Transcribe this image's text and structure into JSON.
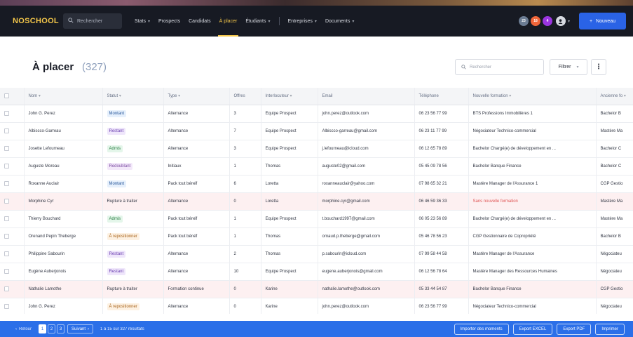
{
  "app": {
    "logo": "NOSCHOOL",
    "search_placeholder": "Rechercher",
    "nav": [
      {
        "label": "Stats",
        "dropdown": true,
        "active": false
      },
      {
        "label": "Prospects",
        "dropdown": false,
        "active": false
      },
      {
        "label": "Candidats",
        "dropdown": false,
        "active": false
      },
      {
        "label": "À placer",
        "dropdown": false,
        "active": true
      },
      {
        "label": "Étudiants",
        "dropdown": true,
        "active": false
      },
      {
        "label": "Entreprises",
        "dropdown": true,
        "active": false
      },
      {
        "label": "Documents",
        "dropdown": true,
        "active": false
      }
    ],
    "avatars": [
      {
        "label": "23",
        "color": "#6b7c93"
      },
      {
        "label": "18",
        "color": "#f0663a"
      },
      {
        "label": "4",
        "color": "#9b35e0"
      }
    ],
    "new_button": "Nouveau"
  },
  "page": {
    "title": "À placer",
    "count": "(327)",
    "search_placeholder": "Rechercher",
    "filter_label": "Filtrer",
    "more_label": "⋮"
  },
  "table": {
    "columns": [
      "Nom",
      "Statut",
      "Type",
      "Offres",
      "Interlocuteur",
      "Email",
      "Téléphone",
      "Nouvelle formation",
      "Ancienne fo"
    ],
    "rows": [
      {
        "nom": "John G. Perez",
        "statut": "Montant",
        "type": "Alternance",
        "offres": "3",
        "interlocuteur": "Equipe Prospect",
        "email": "john.perez@outlook.com",
        "tel": "06 23 56 77 99",
        "nouvelle": "BTS Professions Immobilières 1",
        "ancienne": "Bachelor B",
        "alert": false
      },
      {
        "nom": "Albiscco-Garreau",
        "statut": "Restant",
        "type": "Alternance",
        "offres": "7",
        "interlocuteur": "Equipe Prospect",
        "email": "Albiscco-garreau@gmail.com",
        "tel": "06 23 11 77 99",
        "nouvelle": "Négociateur Technico-commercial",
        "ancienne": "Mastère Ma",
        "alert": false
      },
      {
        "nom": "Josette Lefourneau",
        "statut": "Admis",
        "type": "Alternance",
        "offres": "3",
        "interlocuteur": "Equipe Prospect",
        "email": "j.lefourneau@icloud.com",
        "tel": "06 12 65 78 89",
        "nouvelle": "Bachelor Chargé(e) de développement en ...",
        "ancienne": "Bachelor C",
        "alert": false
      },
      {
        "nom": "Auguste Moreau",
        "statut": "Redoublant",
        "type": "Initiaux",
        "offres": "1",
        "interlocuteur": "Thomas",
        "email": "auguste02@gmail.com",
        "tel": "05 45 09 78 56",
        "nouvelle": "Bachelor Banque Finance",
        "ancienne": "Bachelor C",
        "alert": false
      },
      {
        "nom": "Roxanne Auclair",
        "statut": "Montant",
        "type": "Pack tout bénéf",
        "offres": "6",
        "interlocuteur": "Loretta",
        "email": "roxanneauclair@yahoo.com",
        "tel": "07 98 65 32 21",
        "nouvelle": "Mastère Manager de l'Assurance 1",
        "ancienne": "CGP Gestio",
        "alert": false
      },
      {
        "nom": "Morphine Cyr",
        "statut": "Rupture à traiter",
        "type": "Alternance",
        "offres": "0",
        "interlocuteur": "Loretta",
        "email": "morphine.cyr@gmail.com",
        "tel": "06 46 59 36 33",
        "nouvelle": "Sans nouvelle formation",
        "ancienne": "Mastère Ma",
        "alert": true
      },
      {
        "nom": "Thierry Bouchard",
        "statut": "Admis",
        "type": "Pack tout bénéf",
        "offres": "1",
        "interlocuteur": "Equipe Prospect",
        "email": "t.bouchard1997@gmail.com",
        "tel": "06 05 23 56 89",
        "nouvelle": "Bachelor Chargé(e) de développement en ...",
        "ancienne": "Mastère Ma",
        "alert": false
      },
      {
        "nom": "Orenand Pepin Theberge",
        "statut": "À repositionner",
        "type": "Pack tout bénéf",
        "offres": "1",
        "interlocuteur": "Thomas",
        "email": "ornaud.p.theberge@gmail.com",
        "tel": "05 46 78 56 23",
        "nouvelle": "CGP Gestionnaire de Copropriété",
        "ancienne": "Bachelor B",
        "alert": false
      },
      {
        "nom": "Philippine Sabourin",
        "statut": "Restant",
        "type": "Alternance",
        "offres": "2",
        "interlocuteur": "Thomas",
        "email": "p.sabourin@icloud.com",
        "tel": "07 99 58 44 58",
        "nouvelle": "Mastère Manager de l'Assurance",
        "ancienne": "Négociateu",
        "alert": false
      },
      {
        "nom": "Eugène Auberjonois",
        "statut": "Restant",
        "type": "Alternance",
        "offres": "10",
        "interlocuteur": "Equipe Prospect",
        "email": "eugene.auberjonois@gmail.com",
        "tel": "06 12 56 78 64",
        "nouvelle": "Mastère Manager des Ressources Humaines",
        "ancienne": "Négociateu",
        "alert": false
      },
      {
        "nom": "Nathalie Lamothe",
        "statut": "Rupture à traiter",
        "type": "Formation continue",
        "offres": "0",
        "interlocuteur": "Karine",
        "email": "nathalie.lamothe@outlook.com",
        "tel": "05 33 44 54 87",
        "nouvelle": "Bachelor Banque Finance",
        "ancienne": "CGP Gestio",
        "alert": true
      },
      {
        "nom": "John G. Perez",
        "statut": "À repositionner",
        "type": "Alternance",
        "offres": "0",
        "interlocuteur": "Karine",
        "email": "john.perez@outlook.com",
        "tel": "06 23 56 77 99",
        "nouvelle": "Négociateur Technico-commercial",
        "ancienne": "Négociateu",
        "alert": false
      }
    ]
  },
  "badges": {
    "Montant": {
      "bg": "#e6f0fc",
      "fg": "#2c5a9c"
    },
    "Restant": {
      "bg": "#efe6fb",
      "fg": "#6a3fb0"
    },
    "Admis": {
      "bg": "#e4f6ea",
      "fg": "#2e8047"
    },
    "Redoublant": {
      "bg": "#f3e8fa",
      "fg": "#7a4ba0"
    },
    "À repositionner": {
      "bg": "#fdf1e2",
      "fg": "#a8641c"
    }
  },
  "footer": {
    "prev": "Retour",
    "pages": [
      "1",
      "2",
      "3"
    ],
    "next": "Suivant",
    "results": "1 à 15 sur 327 résultats",
    "actions": [
      "Importer des moments",
      "Export EXCEL",
      "Export PDF",
      "Imprimer"
    ]
  }
}
